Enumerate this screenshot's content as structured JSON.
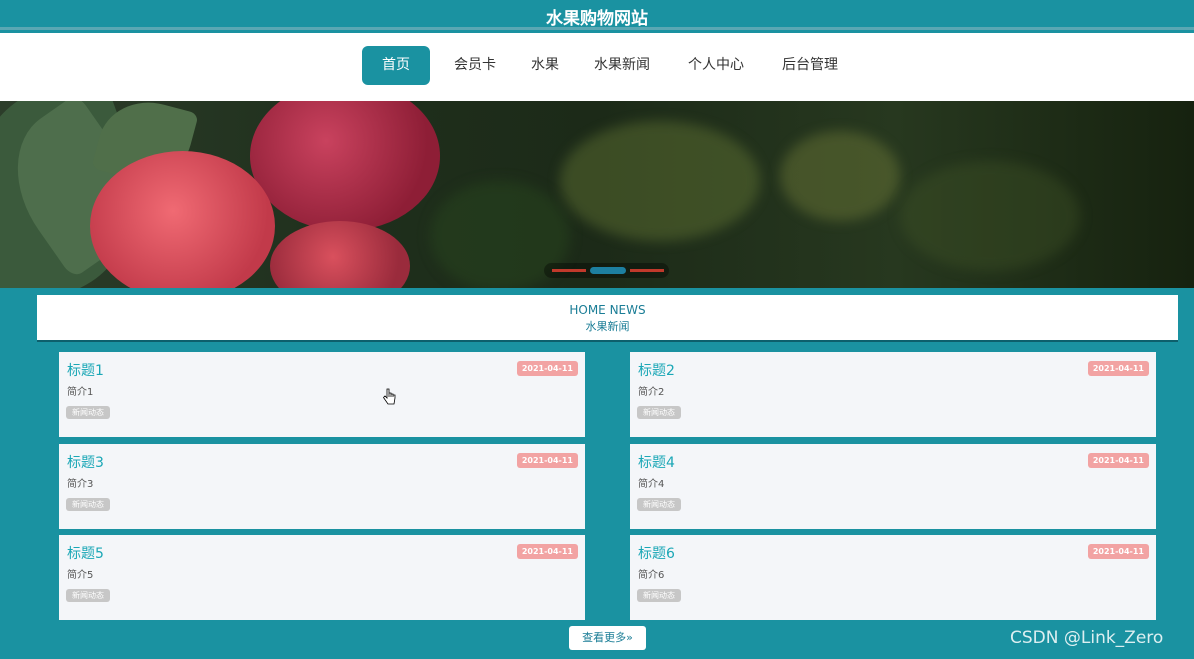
{
  "header": {
    "title": "水果购物网站"
  },
  "nav": {
    "items": [
      {
        "label": "首页"
      },
      {
        "label": "会员卡"
      },
      {
        "label": "水果"
      },
      {
        "label": "水果新闻"
      },
      {
        "label": "个人中心"
      },
      {
        "label": "后台管理"
      }
    ],
    "active": "首页"
  },
  "banner": {
    "slides_count": 3,
    "active_slide": 2,
    "image": "raspberries"
  },
  "section": {
    "title_en": "HOME NEWS",
    "title_cn": "水果新闻"
  },
  "news": [
    {
      "title": "标题1",
      "desc": "简介1",
      "tag": "新闻动态",
      "date": "2021-04-11"
    },
    {
      "title": "标题2",
      "desc": "简介2",
      "tag": "新闻动态",
      "date": "2021-04-11"
    },
    {
      "title": "标题3",
      "desc": "简介3",
      "tag": "新闻动态",
      "date": "2021-04-11"
    },
    {
      "title": "标题4",
      "desc": "简介4",
      "tag": "新闻动态",
      "date": "2021-04-11"
    },
    {
      "title": "标题5",
      "desc": "简介5",
      "tag": "新闻动态",
      "date": "2021-04-11"
    },
    {
      "title": "标题6",
      "desc": "简介6",
      "tag": "新闻动态",
      "date": "2021-04-11"
    }
  ],
  "more_button": {
    "label": "查看更多»"
  },
  "watermark": "CSDN @Link_Zero",
  "colors": {
    "primary": "#1a92a1",
    "date_badge": "#f2a3a3",
    "tag_badge": "#c7c7c7",
    "card_bg": "#f4f6f9"
  }
}
